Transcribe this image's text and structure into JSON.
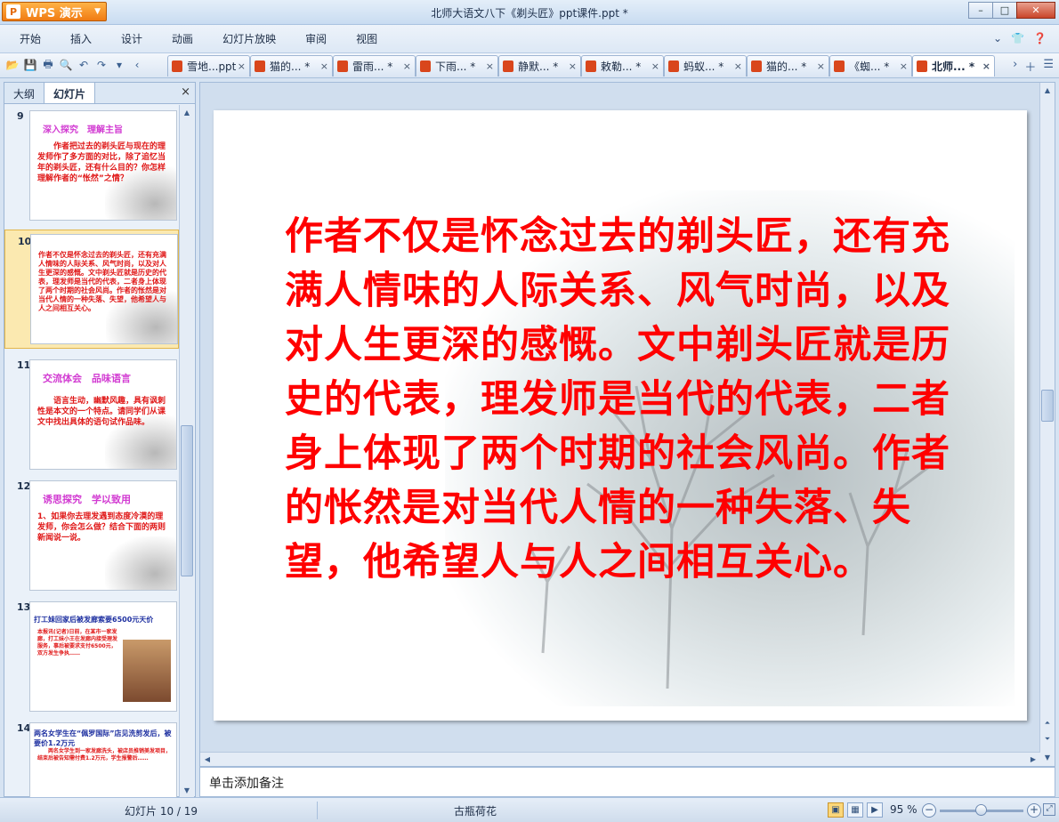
{
  "app": {
    "button_label": "WPS 演示",
    "logo_letter": "P",
    "window_title": "北师大语文八下《剃头匠》ppt课件.ppt *",
    "controls": {
      "minimize": "–",
      "maximize": "□",
      "close": "✕"
    }
  },
  "menu": {
    "items": [
      "开始",
      "插入",
      "设计",
      "动画",
      "幻灯片放映",
      "审阅",
      "视图"
    ],
    "right_icons": [
      "chevron-down-icon",
      "shirt-icon",
      "help-icon"
    ]
  },
  "toolbar": {
    "tabs": [
      {
        "label": "雪地...ppt",
        "close": "×"
      },
      {
        "label": "猫的... *",
        "close": "×"
      },
      {
        "label": "雷雨... *",
        "close": "×"
      },
      {
        "label": "下雨... *",
        "close": "×"
      },
      {
        "label": "静默... *",
        "close": "×"
      },
      {
        "label": "敕勒... *",
        "close": "×"
      },
      {
        "label": "蚂蚁... *",
        "close": "×"
      },
      {
        "label": "猫的... *",
        "close": "×"
      },
      {
        "label": "《蜘... *",
        "close": "×"
      },
      {
        "label": "北师... *",
        "close": "×"
      }
    ],
    "active_tab_index": 9
  },
  "left_panel": {
    "tabs": [
      "大纲",
      "幻灯片"
    ],
    "active_tab": "幻灯片",
    "close": "×",
    "slides": [
      {
        "num": "9",
        "head": "深入探究　理解主旨",
        "body": "　　作者把过去的剃头匠与现在的理发师作了多方面的对比，除了追忆当年的剃头匠，还有什么目的？你怎样理解作者的“怅然”之情？"
      },
      {
        "num": "10",
        "head": "",
        "body": "作者不仅是怀念过去的剃头匠，还有充满人情味的人际关系、风气时尚，以及对人生更深的感慨。文中剃头匠就是历史的代表，理发师是当代的代表，二者身上体现了两个时期的社会风尚。作者的怅然是对当代人情的一种失落、失望，他希望人与人之间相互关心。"
      },
      {
        "num": "11",
        "head": "交流体会　品味语言",
        "body": "　　语言生动，幽默风趣，具有讽刺性是本文的一个特点。请同学们从课文中找出具体的语句试作品味。"
      },
      {
        "num": "12",
        "head": "诱思探究　学以致用",
        "body": "1、如果你去理发遇到态度冷漠的理发师，你会怎么做？结合下面的两则新闻说一说。"
      },
      {
        "num": "13",
        "head": "打工妹回家后被发廊索要6500元天价",
        "body": "本报讯(记者)日前，在某市一家发廊，打工妹小王在发廊内接受理发服务，事后被要求支付6500元，双方发生争执……"
      },
      {
        "num": "14",
        "head": "两名女学生在“佩罗国际”店见洗剪发后，被要价1.2万元",
        "body": "　　两名女学生到一家发廊洗头，被店员推销美发项目，结束后被告知需付费1.2万元，学生报警后……"
      }
    ],
    "selected_num": "10"
  },
  "slide": {
    "text": "作者不仅是怀念过去的剃头匠，还有充满人情味的人际关系、风气时尚，以及对人生更深的感慨。文中剃头匠就是历史的代表，理发师是当代的代表，二者身上体现了两个时期的社会风尚。作者的怅然是对当代人情的一种失落、失望，他希望人与人之间相互关心。",
    "text_color": "#ff0000"
  },
  "notes": {
    "placeholder": "单击添加备注"
  },
  "status": {
    "slide_indicator": "幻灯片 10 / 19",
    "theme": "古瓶荷花",
    "zoom": "95 %",
    "zoom_level": 0.5,
    "views": [
      "normal-view-icon",
      "sorter-view-icon",
      "slideshow-view-icon"
    ]
  }
}
